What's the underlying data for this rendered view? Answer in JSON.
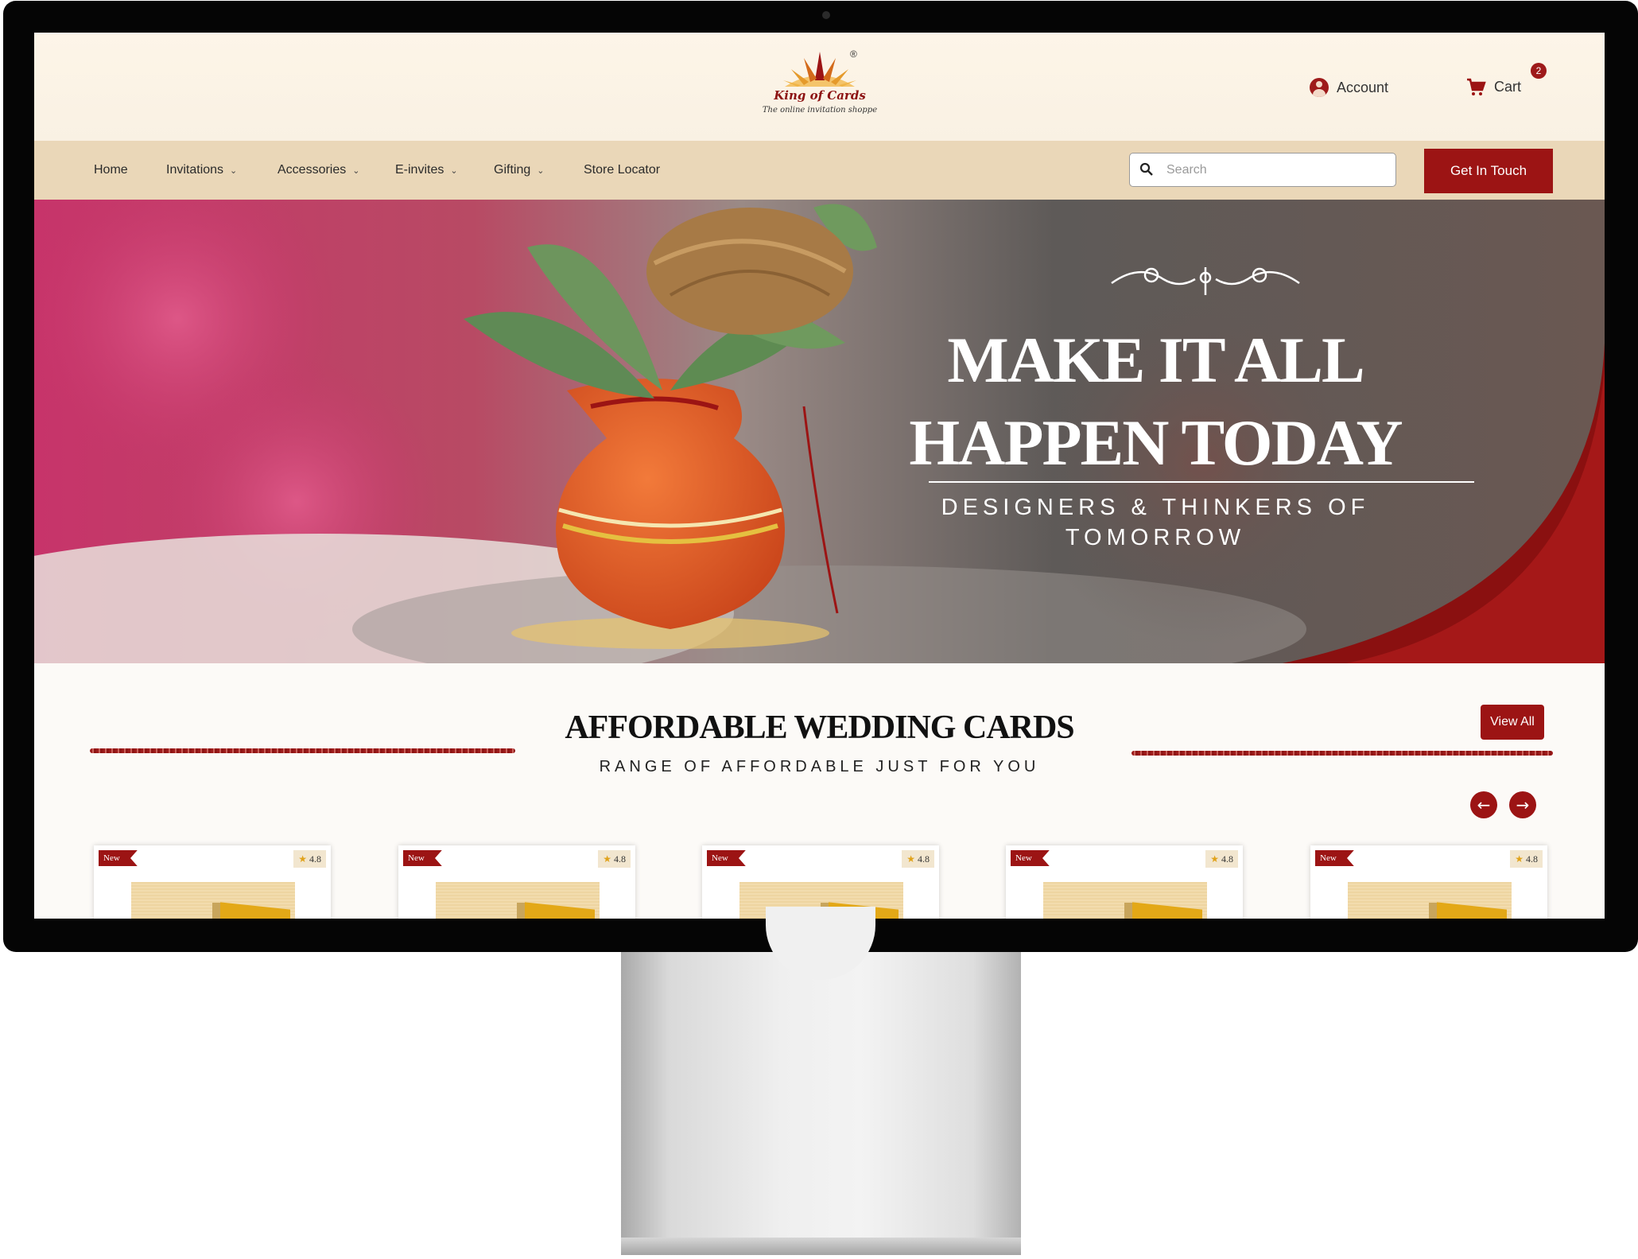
{
  "brand": {
    "name": "King of Cards",
    "tagline": "The online invitation shoppe",
    "registered": "®"
  },
  "header": {
    "account_label": "Account",
    "cart_label": "Cart",
    "cart_count": "2"
  },
  "nav": {
    "items": [
      {
        "label": "Home",
        "dropdown": false
      },
      {
        "label": "Invitations",
        "dropdown": true
      },
      {
        "label": "Accessories",
        "dropdown": true
      },
      {
        "label": "E-invites",
        "dropdown": true
      },
      {
        "label": "Gifting",
        "dropdown": true
      },
      {
        "label": "Store Locator",
        "dropdown": false
      }
    ],
    "search_placeholder": "Search",
    "cta_label": "Get In Touch"
  },
  "hero": {
    "title_line1": "MAKE IT ALL",
    "title_line2": "HAPPEN TODAY",
    "subtitle_line1": "DESIGNERS & THINKERS OF",
    "subtitle_line2": "TOMORROW"
  },
  "section": {
    "title": "AFFORDABLE WEDDING CARDS",
    "subtitle": "RANGE OF AFFORDABLE JUST FOR YOU",
    "view_all_label": "View All",
    "prev_icon": "arrow-left-icon",
    "next_icon": "arrow-right-icon"
  },
  "products": [
    {
      "tag": "New",
      "rating": "4.8"
    },
    {
      "tag": "New",
      "rating": "4.8"
    },
    {
      "tag": "New",
      "rating": "4.8"
    },
    {
      "tag": "New",
      "rating": "4.8"
    },
    {
      "tag": "New",
      "rating": "4.8"
    }
  ],
  "colors": {
    "primary": "#9c1414",
    "nav_bg": "#ead7b8",
    "header_bg": "#fdf5e8",
    "page_bg": "#fcfaf7"
  }
}
